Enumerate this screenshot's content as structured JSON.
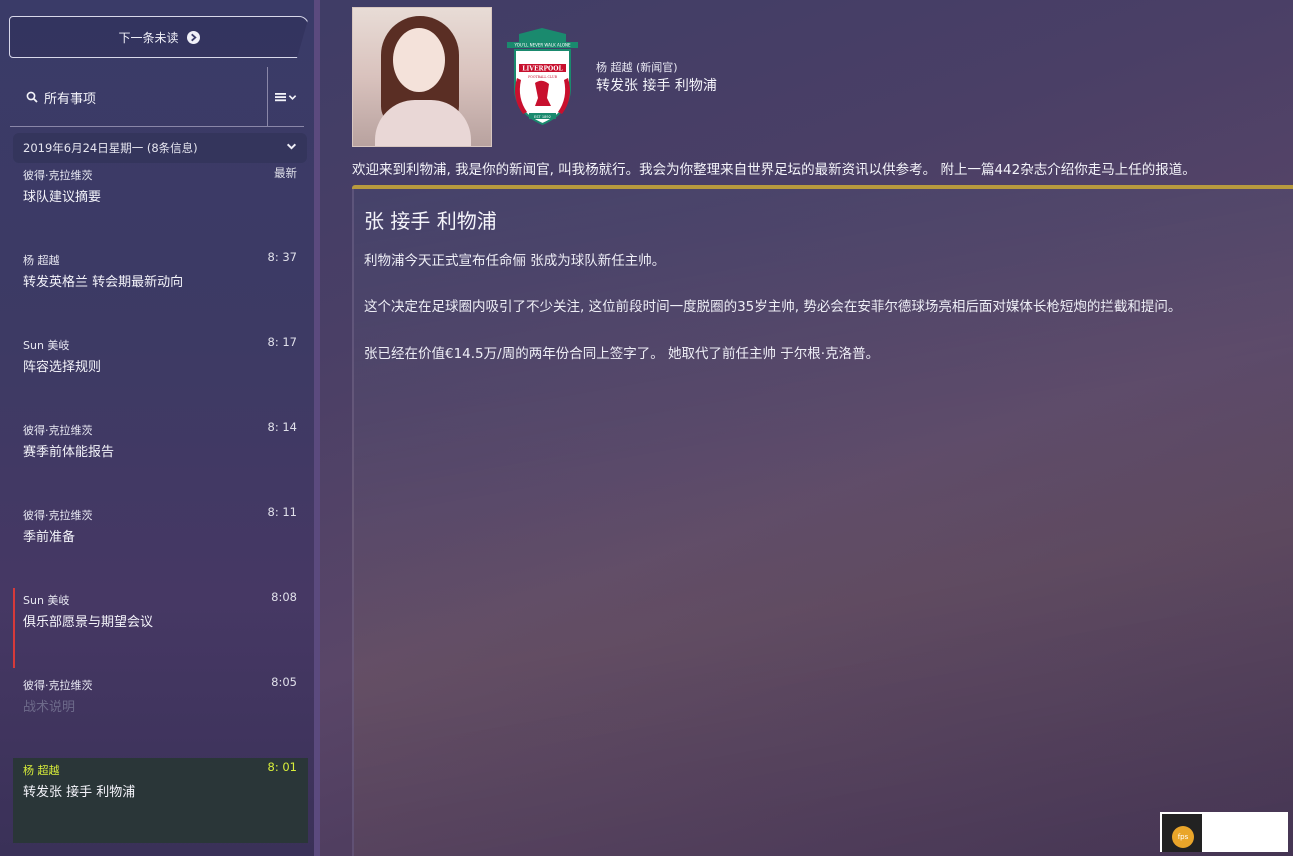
{
  "sidebar": {
    "next_unread_label": "下一条未读",
    "filter_label": "所有事项",
    "date_header": "2019年6月24日星期一 (8条信息)",
    "messages": [
      {
        "sender": "彼得·克拉维茨",
        "time": "最新",
        "subject": "球队建议摘要"
      },
      {
        "sender": "杨 超越",
        "time": "8: 37",
        "subject": "转发英格兰 转会期最新动向"
      },
      {
        "sender": "Sun 美岐",
        "time": "8: 17",
        "subject": "阵容选择规则"
      },
      {
        "sender": "彼得·克拉维茨",
        "time": "8: 14",
        "subject": "赛季前体能报告"
      },
      {
        "sender": "彼得·克拉维茨",
        "time": "8: 11",
        "subject": "季前准备"
      },
      {
        "sender": "Sun 美岐",
        "time": "8:08",
        "subject": "俱乐部愿景与期望会议"
      },
      {
        "sender": "彼得·克拉维茨",
        "time": "8:05",
        "subject": "战术说明"
      },
      {
        "sender": "杨 超越",
        "time": "8: 01",
        "subject": "转发张 接手 利物浦"
      }
    ]
  },
  "message": {
    "sender": "杨 超越 (新闻官)",
    "subject": "转发张 接手 利物浦",
    "intro": "欢迎来到利物浦, 我是你的新闻官, 叫我杨就行。我会为你整理来自世界足坛的最新资讯以供参考。 附上一篇442杂志介绍你走马上任的报道。",
    "badge_top_text": "YOU'LL NEVER WALK ALONE",
    "badge_name": "LIVERPOOL",
    "badge_sub": "FOOTBALL CLUB",
    "badge_est": "EST 1892"
  },
  "article": {
    "title": "张 接手 利物浦",
    "p1": "利物浦今天正式宣布任命俪 张成为球队新任主帅。",
    "p2": "这个决定在足球圈内吸引了不少关注, 这位前段时间一度脱圈的35岁主帅, 势必会在安菲尔德球场亮相后面对媒体长枪短炮的拦截和提问。",
    "p3": "张已经在价值€14.5万/周的两年份合同上签字了。 她取代了前任主帅 于尔根·克洛普。"
  },
  "overlay": {
    "badge_text": "fps"
  },
  "colors": {
    "accent_gold": "#b89a3e",
    "selected_text": "#d8ee3a",
    "flag_red": "#d63a3a",
    "liverpool_red": "#c8102e",
    "liverpool_green": "#1a8a6e"
  }
}
